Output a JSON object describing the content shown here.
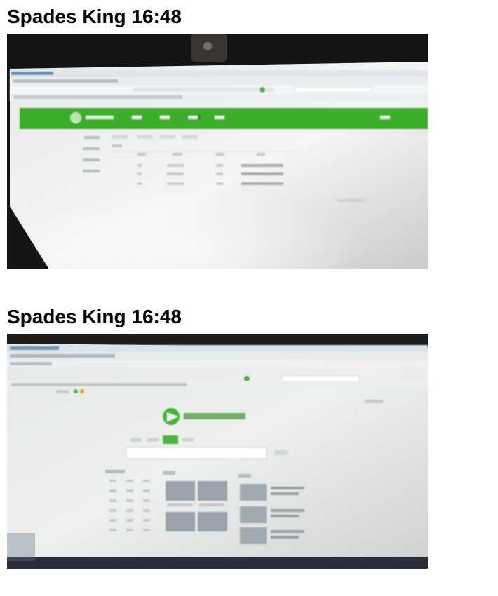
{
  "posts": [
    {
      "title": "Spades King 16:48"
    },
    {
      "title": "Spades King 16:48"
    }
  ],
  "colors": {
    "nav_green": "#3dae2b",
    "screen_bg": "#eef1ef",
    "bezel": "#151515"
  }
}
